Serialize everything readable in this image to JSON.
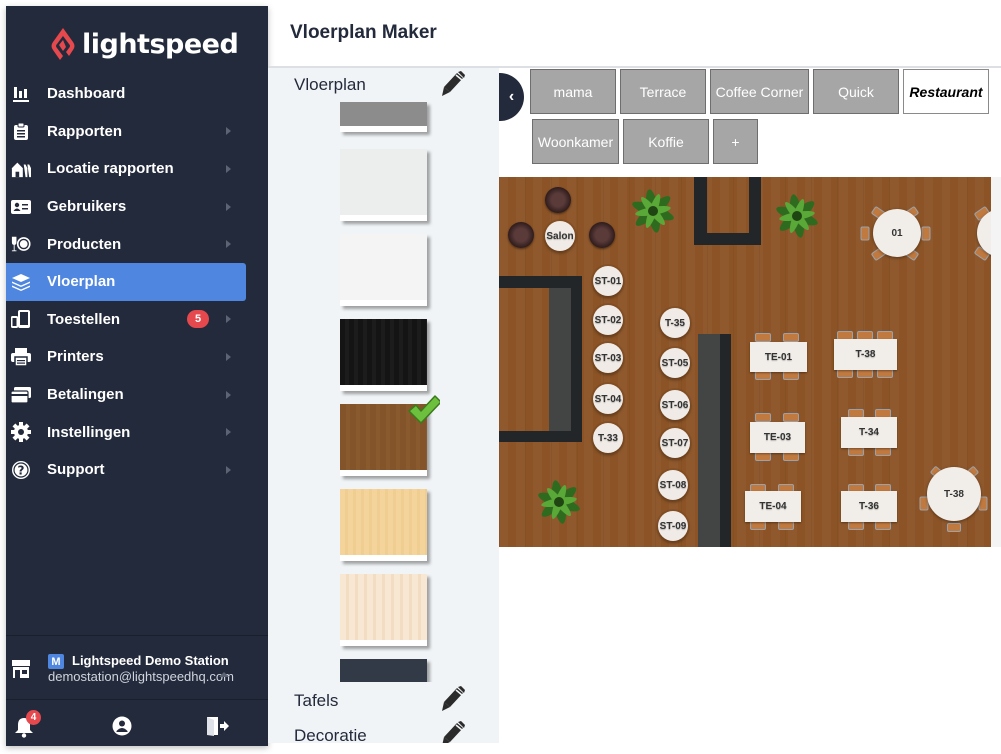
{
  "sidebar": {
    "brand": "lightspeed",
    "brand_color": "#e5484d",
    "active_color": "#4f86e0",
    "items": [
      {
        "label": "Dashboard",
        "icon": "bar-chart-icon",
        "has_submenu": false
      },
      {
        "label": "Rapporten",
        "icon": "clipboard-icon",
        "has_submenu": true
      },
      {
        "label": "Locatie rapporten",
        "icon": "buildings-icon",
        "has_submenu": true
      },
      {
        "label": "Gebruikers",
        "icon": "id-card-icon",
        "has_submenu": true
      },
      {
        "label": "Producten",
        "icon": "plate-glass-icon",
        "has_submenu": true
      },
      {
        "label": "Vloerplan",
        "icon": "layers-icon",
        "has_submenu": false,
        "active": true
      },
      {
        "label": "Toestellen",
        "icon": "devices-icon",
        "has_submenu": true,
        "badge": "5"
      },
      {
        "label": "Printers",
        "icon": "printer-icon",
        "has_submenu": true
      },
      {
        "label": "Betalingen",
        "icon": "credit-cards-icon",
        "has_submenu": true
      },
      {
        "label": "Instellingen",
        "icon": "gear-icon",
        "has_submenu": true
      },
      {
        "label": "Support",
        "icon": "question-circle-icon",
        "has_submenu": true
      }
    ],
    "station": {
      "initial": "M",
      "name": "Lightspeed Demo Station",
      "email": "demostation@lightspeedhq.com"
    },
    "notifications_count": "4"
  },
  "header": {
    "title": "Vloerplan Maker"
  },
  "panel": {
    "sections": [
      {
        "label": "Vloerplan"
      },
      {
        "label": "Tafels"
      },
      {
        "label": "Decoratie"
      }
    ],
    "swatches": [
      {
        "name": "grey-concrete",
        "color": "#8c8c8c"
      },
      {
        "name": "light-grey",
        "color": "#eceeed"
      },
      {
        "name": "white",
        "color": "#f4f4f4"
      },
      {
        "name": "black-wood",
        "color": "#141414"
      },
      {
        "name": "brown-wood",
        "color": "#83532a",
        "selected": true
      },
      {
        "name": "light-oak",
        "color": "#f5d49b"
      },
      {
        "name": "birch",
        "color": "#f6e3cc"
      },
      {
        "name": "dark-slate",
        "color": "#323947"
      }
    ]
  },
  "tabs": {
    "row1": [
      "mama",
      "Terrace",
      "Coffee Corner",
      "Quick",
      "Restaurant"
    ],
    "row2": [
      "Woonkamer",
      "Koffie",
      "+"
    ],
    "active": "Restaurant"
  },
  "floorplan": {
    "background": "brown-wood",
    "stools": [
      "Salon",
      "ST-01",
      "ST-02",
      "ST-03",
      "ST-04",
      "T-33",
      "T-35",
      "ST-05",
      "ST-06",
      "ST-07",
      "ST-08",
      "ST-09"
    ],
    "tables": [
      "TE-01",
      "T-38",
      "TE-03",
      "T-34",
      "TE-04",
      "T-36"
    ],
    "round_tables": [
      "01",
      "T-38"
    ]
  }
}
